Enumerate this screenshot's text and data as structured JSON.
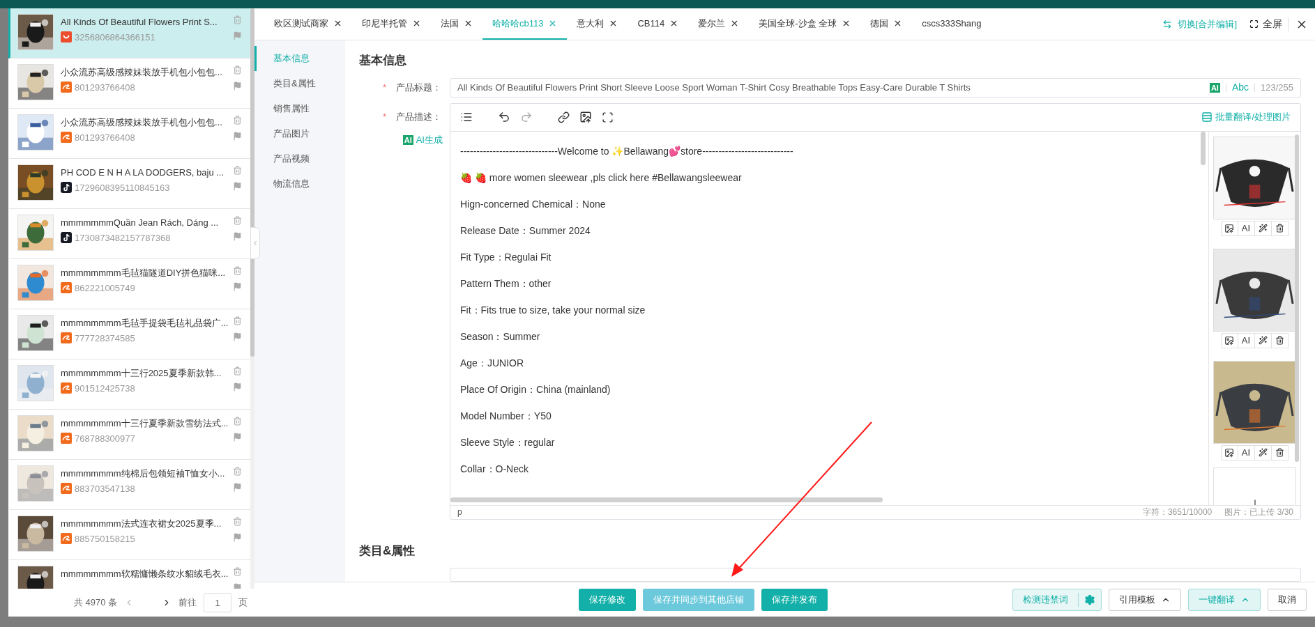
{
  "product_list": {
    "items": [
      {
        "title": "All Kinds Of Beautiful Flowers Print S...",
        "id": "3256806864366151",
        "kind": "shopee",
        "selected": true
      },
      {
        "title": "小众流苏高级感辣妹装放手机包小包包...",
        "id": "801293766408",
        "kind": "alibaba",
        "selected": false
      },
      {
        "title": "小众流苏高级感辣妹装放手机包小包包...",
        "id": "801293766408",
        "kind": "alibaba",
        "selected": false
      },
      {
        "title": "PH COD E N H A LA DODGERS, baju ...",
        "id": "1729608395110845163",
        "kind": "tiktok",
        "selected": false
      },
      {
        "title": "mmmmmmmQuần Jean Rách, Dáng ...",
        "id": "1730873482157787368",
        "kind": "tiktok",
        "selected": false
      },
      {
        "title": "mmmmmmmm毛毡猫隧道DIY拼色猫咪...",
        "id": "862221005749",
        "kind": "alibaba",
        "selected": false
      },
      {
        "title": "mmmmmmmm毛毡手提袋毛毡礼品袋广...",
        "id": "777728374585",
        "kind": "alibaba",
        "selected": false
      },
      {
        "title": "mmmmmmmm十三行2025夏季新款韩...",
        "id": "901512425738",
        "kind": "alibaba",
        "selected": false
      },
      {
        "title": "mmmmmmmm十三行夏季新款雪纺法式...",
        "id": "768788300977",
        "kind": "alibaba",
        "selected": false
      },
      {
        "title": "mmmmmmmm纯棉后包领短袖T恤女小...",
        "id": "883703547138",
        "kind": "alibaba",
        "selected": false
      },
      {
        "title": "mmmmmmmm法式连衣裙女2025夏季...",
        "id": "885750158215",
        "kind": "alibaba",
        "selected": false
      },
      {
        "title": "mmmmmmmm软糯慵懒条纹水貂绒毛衣...",
        "selected": false
      }
    ],
    "pagination": {
      "total": "共 4970 条",
      "goto": "前往",
      "page": "1",
      "unit": "页"
    }
  },
  "tabs": [
    {
      "label": "欧区测试商家",
      "selected": false
    },
    {
      "label": "印尼半托管",
      "selected": false
    },
    {
      "label": "法国",
      "selected": false
    },
    {
      "label": "哈哈哈cb113",
      "selected": true
    },
    {
      "label": "意大利",
      "selected": false
    },
    {
      "label": "CB114",
      "selected": false
    },
    {
      "label": "爱尔兰",
      "selected": false
    },
    {
      "label": "美国全球-沙盒 全球",
      "selected": false
    },
    {
      "label": "德国",
      "selected": false
    },
    {
      "label": "cscs333Shang",
      "selected": false,
      "closable": false
    }
  ],
  "header_actions": {
    "switch": "切换[合并编辑]",
    "fullscreen": "全屏"
  },
  "side_nav": [
    {
      "label": "基本信息",
      "selected": true
    },
    {
      "label": "类目&属性",
      "selected": false
    },
    {
      "label": "销售属性",
      "selected": false
    },
    {
      "label": "产品图片",
      "selected": false
    },
    {
      "label": "产品视频",
      "selected": false
    },
    {
      "label": "物流信息",
      "selected": false
    }
  ],
  "form": {
    "section_title": "基本信息",
    "title_field": {
      "label": "产品标题：",
      "required_mark": "*",
      "value": "All Kinds Of Beautiful Flowers Print Short Sleeve Loose Sport Woman T-Shirt Cosy Breathable Tops Easy-Care Durable T Shirts",
      "ai_badge": "AI",
      "abc": "Abc",
      "count": "123/255"
    },
    "description": {
      "label": "产品描述：",
      "required_mark": "*",
      "ai_badge": "AI",
      "ai_generate": "AI生成",
      "batch": "批量翻译/处理图片",
      "lines": [
        "------------------------------Welcome to ✨Bellawang💕store----------------------------",
        "🍓 🍓  more women sleewear ,pls click here #Bellawangsleewear",
        "Hign-concerned Chemical：None",
        "Release Date：Summer 2024",
        "Fit Type：Regulai Fit",
        "Pattern Them：other",
        "Fit：Fits true to size, take your normal size",
        "Season：Summer",
        "Age：JUNIOR",
        "Place Of Origin：China (mainland)",
        "Model Number：Y50",
        "Sleeve Style：regular",
        "Collar：O-Neck"
      ],
      "path_tag": "p",
      "chars": "字符：3651/10000",
      "images_count": "图片：已上传 3/30",
      "images": [
        {
          "tool_label": "AI"
        },
        {
          "tool_label": "AI"
        },
        {
          "tool_label": "AI"
        }
      ]
    }
  },
  "next_section_title": "类目&属性",
  "footer": {
    "center": [
      {
        "label": "保存修改",
        "kind": "primary"
      },
      {
        "label": "保存并同步到其他店铺",
        "kind": "light"
      },
      {
        "label": "保存并发布",
        "kind": "primary"
      }
    ],
    "right": [
      {
        "label": "检测违禁词",
        "kind": "gear"
      },
      {
        "label": "引用模板",
        "kind": "dropdown"
      },
      {
        "label": "一键翻译",
        "kind": "accent-dropdown"
      },
      {
        "label": "取消",
        "kind": "plain"
      }
    ]
  }
}
